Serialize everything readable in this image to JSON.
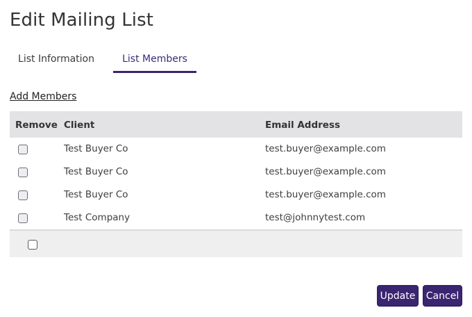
{
  "page": {
    "title": "Edit Mailing List"
  },
  "tabs": [
    {
      "label": "List Information",
      "active": false
    },
    {
      "label": "List Members",
      "active": true
    }
  ],
  "actions": {
    "add_members": "Add Members",
    "update": "Update",
    "cancel": "Cancel"
  },
  "table": {
    "headers": {
      "remove": "Remove",
      "client": "Client",
      "email": "Email Address"
    },
    "rows": [
      {
        "client": "Test Buyer Co",
        "email": "test.buyer@example.com",
        "remove": false
      },
      {
        "client": "Test Buyer Co",
        "email": "test.buyer@example.com",
        "remove": false
      },
      {
        "client": "Test Buyer Co",
        "email": "test.buyer@example.com",
        "remove": false
      },
      {
        "client": "Test Company",
        "email": "test@johnnytest.com",
        "remove": false
      }
    ],
    "select_all": false
  },
  "colors": {
    "accent": "#3a2571",
    "header_bg": "#e3e3e6",
    "footer_bg": "#efefef"
  }
}
